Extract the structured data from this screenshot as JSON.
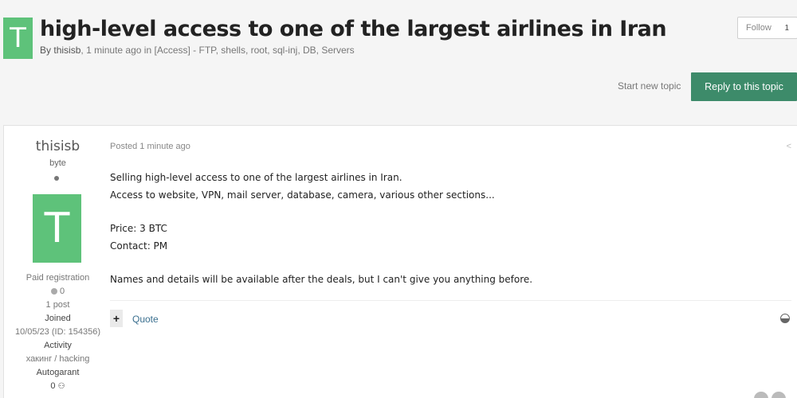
{
  "topic": {
    "avatar_letter": "T",
    "title": "high-level access to one of the largest airlines in Iran",
    "meta_prefix": "By",
    "author": "thisisb",
    "time": "1 minute ago",
    "in_word": "in",
    "forum": "[Access] - FTP, shells, root, sql-inj, DB, Servers"
  },
  "follow": {
    "label": "Follow",
    "count": "1"
  },
  "actions": {
    "start_new_topic": "Start new topic",
    "reply": "Reply to this topic"
  },
  "author": {
    "name": "thisisb",
    "rank": "byte",
    "avatar_letter": "T",
    "group": "Paid registration",
    "reputation": "0",
    "posts": "1 post",
    "joined_label": "Joined",
    "joined_value": "10/05/23 (ID: 154356)",
    "activity_label": "Activity",
    "activity_value": "хакинг / hacking",
    "autogarant_label": "Autogarant",
    "autogarant_value": "0"
  },
  "post": {
    "date": "Posted 1 minute ago",
    "lines": [
      "Selling high-level access to one of the largest airlines in Iran.",
      "Access to website, VPN, mail server, database, camera, various other sections...",
      "Price: 3 BTC",
      "Contact: PM",
      "Names and details will be available after the deals, but I can't give you anything before."
    ],
    "plus": "+",
    "quote": "Quote"
  },
  "icons": {
    "share": "share-icon",
    "online": "online-indicator-icon",
    "reputation": "reputation-icon",
    "guarantee": "handshake-icon",
    "toggle": "multiquote-toggle-icon"
  },
  "colors": {
    "avatar": "#5ec27a",
    "reply_button": "#3d8b6a",
    "link": "#3a6f8f"
  }
}
